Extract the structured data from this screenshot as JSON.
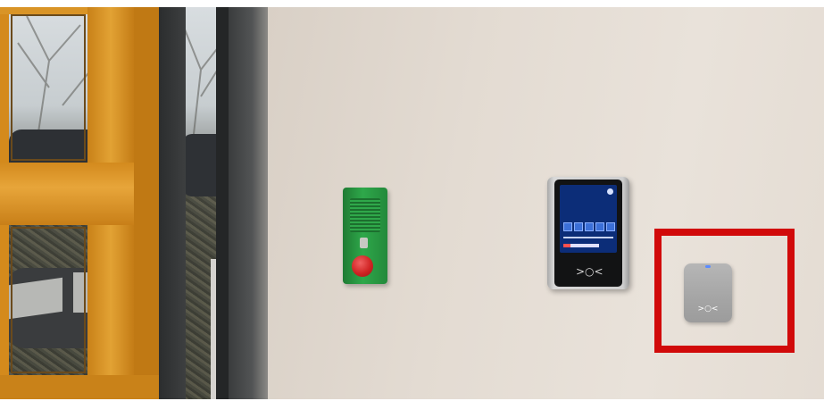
{
  "scene": {
    "description_objects": [
      "glass-door",
      "emergency-release-box",
      "access-terminal",
      "card-reader"
    ]
  },
  "terminal": {
    "nfc_symbol": ">○<"
  },
  "reader": {
    "nfc_symbol": ">○<"
  },
  "colors": {
    "highlight": "#d10a0a",
    "emergency_box": "#2ea84a",
    "emergency_button": "#d02424",
    "door_frame": "#d99426",
    "terminal_screen": "#0c2d78"
  }
}
